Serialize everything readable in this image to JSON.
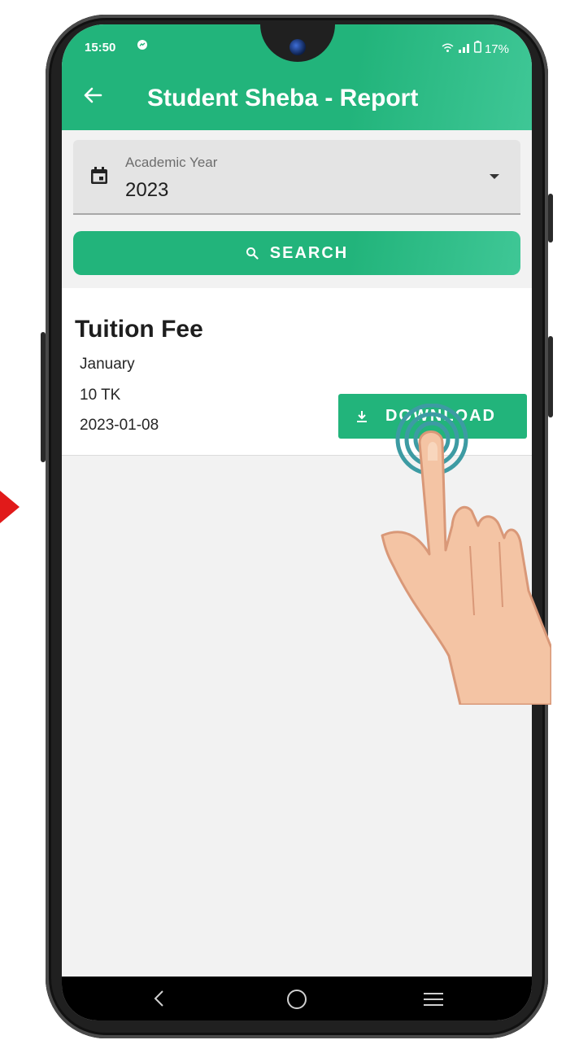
{
  "status_bar": {
    "time": "15:50",
    "battery": "17%"
  },
  "app_bar": {
    "title": "Student Sheba - Report"
  },
  "filter": {
    "label": "Academic Year",
    "value": "2023"
  },
  "search": {
    "label": "SEARCH"
  },
  "report": {
    "title": "Tuition Fee",
    "month": "January",
    "amount": "10 TK",
    "date": "2023-01-08",
    "download_label": "DOWNLOAD"
  },
  "colors": {
    "accent": "#22b47b",
    "highlight_arrow": "#e11a1a"
  },
  "icons": {
    "back": "arrow-left-icon",
    "calendar": "calendar-icon",
    "dropdown": "chevron-down-icon",
    "search": "search-icon",
    "download": "download-icon",
    "nav_back": "nav-back-icon",
    "nav_home": "nav-home-icon",
    "nav_recents": "nav-recents-icon"
  }
}
